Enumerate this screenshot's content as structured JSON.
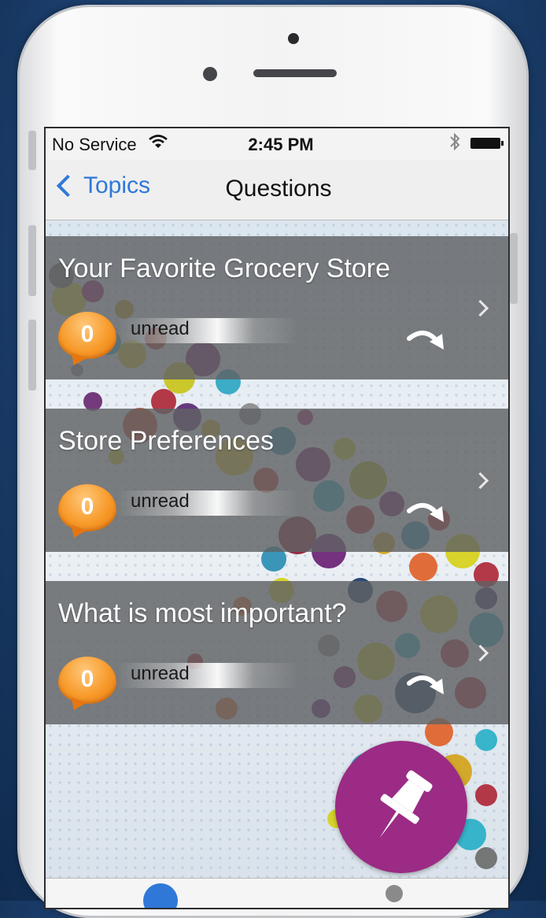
{
  "statusbar": {
    "carrier": "No Service",
    "time": "2:45 PM",
    "wifi_icon": "wifi-icon",
    "bluetooth_icon": "bluetooth-icon",
    "battery_icon": "battery-icon"
  },
  "navbar": {
    "back_label": "Topics",
    "title": "Questions"
  },
  "rows": [
    {
      "title": "Your Favorite Grocery Store",
      "count": "0",
      "unread_label": "unread"
    },
    {
      "title": "Store Preferences",
      "count": "0",
      "unread_label": "unread"
    },
    {
      "title": "What is most important?",
      "count": "0",
      "unread_label": "unread"
    }
  ],
  "colors": {
    "accent": "#2f78d8",
    "badge": "#f79a2a",
    "pin_button": "#9b2b84",
    "row_overlay": "#5f6164"
  },
  "fab": {
    "icon": "pushpin-icon"
  }
}
